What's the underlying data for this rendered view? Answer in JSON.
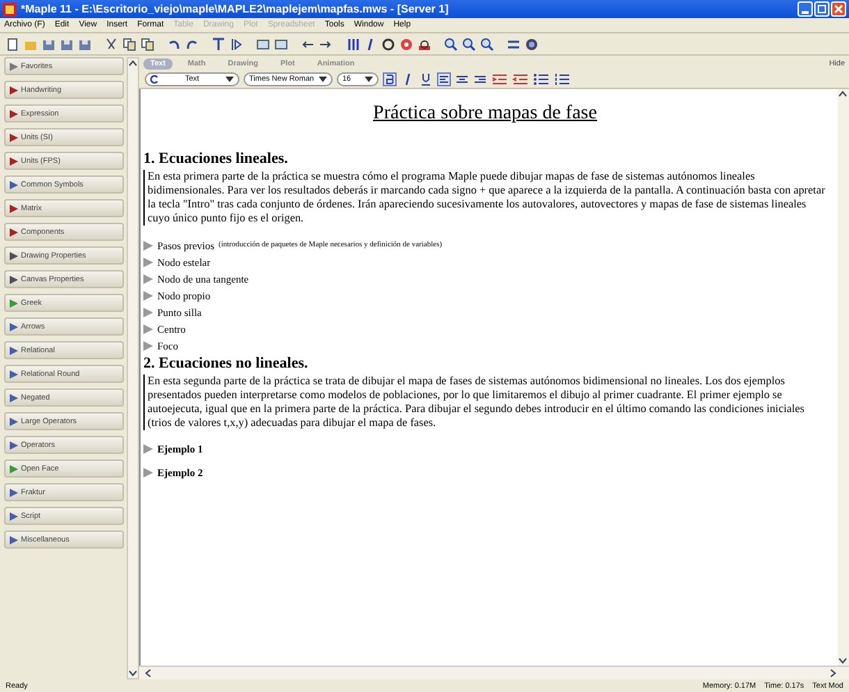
{
  "window": {
    "title": "*Maple 11 - E:\\Escritorio_viejo\\maple\\MAPLE2\\maplejem\\mapfas.mws - [Server 1]"
  },
  "menu": [
    {
      "label": "Archivo (F)",
      "disabled": false
    },
    {
      "label": "Edit",
      "disabled": false
    },
    {
      "label": "View",
      "disabled": false
    },
    {
      "label": "Insert",
      "disabled": false
    },
    {
      "label": "Format",
      "disabled": false
    },
    {
      "label": "Table",
      "disabled": true
    },
    {
      "label": "Drawing",
      "disabled": true
    },
    {
      "label": "Plot",
      "disabled": true
    },
    {
      "label": "Spreadsheet",
      "disabled": true
    },
    {
      "label": "Tools",
      "disabled": false
    },
    {
      "label": "Window",
      "disabled": false
    },
    {
      "label": "Help",
      "disabled": false
    }
  ],
  "palettes": [
    {
      "label": "Favorites",
      "color": "#7a7a7a"
    },
    {
      "label": "Handwriting",
      "color": "#a02828"
    },
    {
      "label": "Expression",
      "color": "#a02828"
    },
    {
      "label": "Units (SI)",
      "color": "#a02828"
    },
    {
      "label": "Units (FPS)",
      "color": "#a02828"
    },
    {
      "label": "Common Symbols",
      "color": "#4a5ea8"
    },
    {
      "label": "Matrix",
      "color": "#a02828"
    },
    {
      "label": "Components",
      "color": "#a02828"
    },
    {
      "label": "Drawing Properties",
      "color": "#505050"
    },
    {
      "label": "Canvas Properties",
      "color": "#505050"
    },
    {
      "label": "Greek",
      "color": "#3a9a3a"
    },
    {
      "label": "Arrows",
      "color": "#4a5ea8"
    },
    {
      "label": "Relational",
      "color": "#4a5ea8"
    },
    {
      "label": "Relational Round",
      "color": "#4a5ea8"
    },
    {
      "label": "Negated",
      "color": "#4a5ea8"
    },
    {
      "label": "Large Operators",
      "color": "#4a5ea8"
    },
    {
      "label": "Operators",
      "color": "#4a5ea8"
    },
    {
      "label": "Open Face",
      "color": "#3a9a3a"
    },
    {
      "label": "Fraktur",
      "color": "#4a5ea8"
    },
    {
      "label": "Script",
      "color": "#4a5ea8"
    },
    {
      "label": "Miscellaneous",
      "color": "#4a5ea8"
    }
  ],
  "context_tabs": [
    {
      "label": "Text",
      "selected": true
    },
    {
      "label": "Math",
      "selected": false
    },
    {
      "label": "Drawing",
      "selected": false
    },
    {
      "label": "Plot",
      "selected": false
    },
    {
      "label": "Animation",
      "selected": false
    }
  ],
  "hide_label": "Hide",
  "format_bar": {
    "style": "Text",
    "font": "Times New Roman",
    "size": "16"
  },
  "document": {
    "title": "Práctica sobre mapas de fase",
    "sections": [
      {
        "heading": "1. Ecuaciones lineales.",
        "paragraph": "En esta primera parte de la práctica se muestra cómo el programa Maple puede dibujar mapas de fase de sistemas autónomos lineales bidimensionales.  Para ver los resultados deberás ir marcando cada signo + que aparece a la izquierda de la pantalla. A continuación basta con apretar la tecla \"Intro\" tras cada conjunto de órdenes. Irán apareciendo sucesivamente los autovalores, autovectores y mapas de fase de sistemas lineales cuyo único punto fijo es el origen.",
        "items": [
          {
            "label": "Pasos previos",
            "note": "(introducción de paquetes de Maple necesarios y definición de variables)",
            "bold": false
          },
          {
            "label": "Nodo estelar",
            "bold": false
          },
          {
            "label": "Nodo de una tangente",
            "bold": false
          },
          {
            "label": "Nodo propio",
            "bold": false
          },
          {
            "label": "Punto silla",
            "bold": false
          },
          {
            "label": "Centro",
            "bold": false
          },
          {
            "label": "Foco",
            "bold": false
          }
        ]
      },
      {
        "heading": "2. Ecuaciones no lineales.",
        "paragraph": "En esta segunda parte de la práctica se trata de dibujar el mapa de fases de  sistemas autónomos bidimensional no lineales. Los dos ejemplos presentados pueden interpretarse como modelos de poblaciones, por lo que limitaremos el dibujo al primer cuadrante. El primer ejemplo se autoejecuta, igual que en  la primera parte de la práctica. Para dibujar el segundo debes introducir en el último comando las condiciones iniciales (trios de valores t,x,y) adecuadas para dibujar el mapa de fases.",
        "items": [
          {
            "label": "Ejemplo 1",
            "bold": true
          },
          {
            "label": "Ejemplo 2",
            "bold": true
          }
        ]
      }
    ]
  },
  "status_bar": {
    "state": "Ready",
    "memory": "Memory: 0.17M",
    "time": "Time: 0.17s",
    "mode": "Text Mod"
  }
}
